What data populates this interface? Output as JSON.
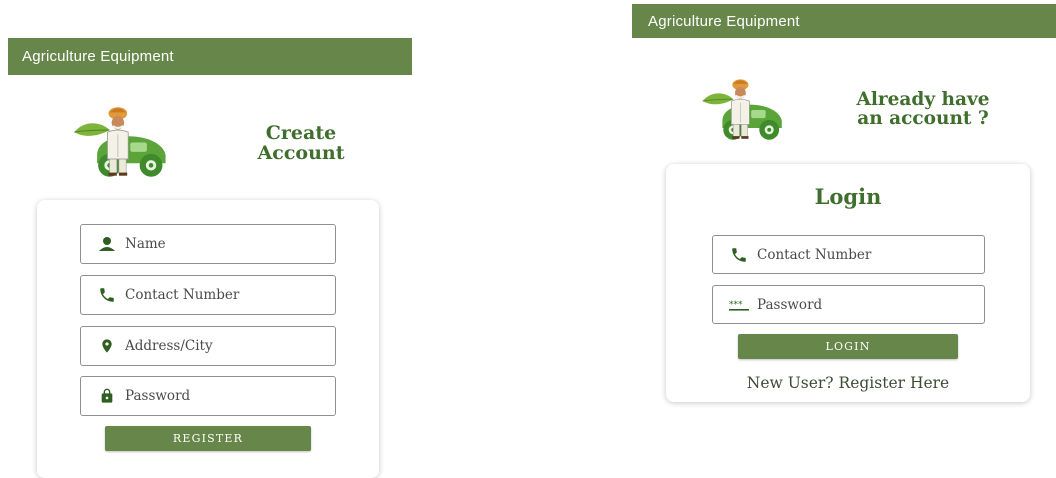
{
  "register_screen": {
    "app_title": "Agriculture Equipment",
    "heading_line1": "Create",
    "heading_line2": "Account",
    "fields": {
      "name": {
        "placeholder": "Name",
        "icon": "person-icon"
      },
      "contact": {
        "placeholder": "Contact Number",
        "icon": "phone-icon"
      },
      "address": {
        "placeholder": "Address/City",
        "icon": "location-pin-icon"
      },
      "password": {
        "placeholder": "Password",
        "icon": "lock-icon"
      }
    },
    "register_label": "REGISTER"
  },
  "login_screen": {
    "app_title": "Agriculture Equipment",
    "heading_line1": "Already have",
    "heading_line2": "an account ?",
    "card_title": "Login",
    "fields": {
      "contact": {
        "placeholder": "Contact Number",
        "icon": "phone-icon"
      },
      "password": {
        "placeholder": "Password",
        "icon": "password-dots-icon"
      }
    },
    "login_label": "LOGIN",
    "register_link": "New User? Register Here"
  },
  "colors": {
    "primary_green": "#67874a",
    "heading_green": "#3f6e2d",
    "icon_green": "#2f5e23",
    "field_border": "#8f8f8f"
  }
}
